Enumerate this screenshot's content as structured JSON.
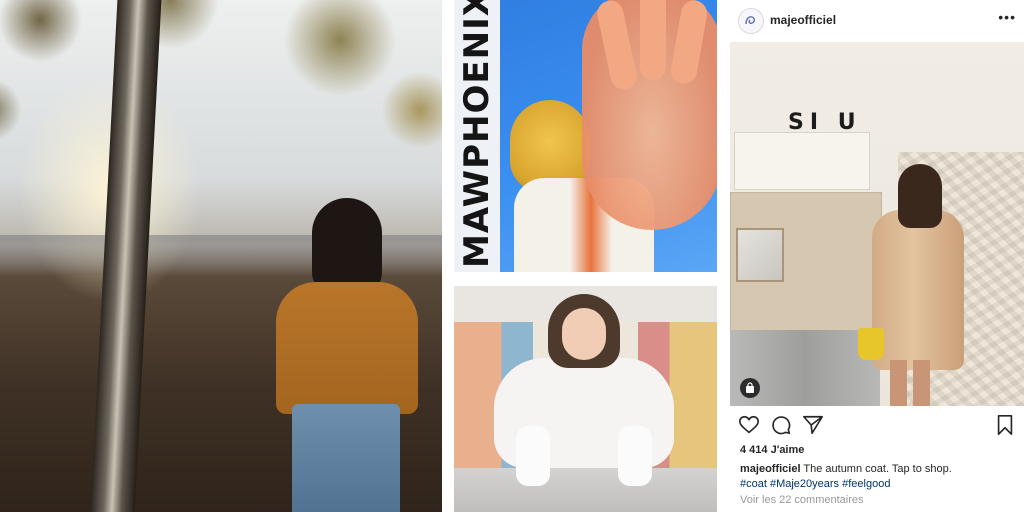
{
  "poster": {
    "title": "MAWPHOENIX"
  },
  "ig_photo": {
    "sign_text": "SI U"
  },
  "instagram": {
    "username": "majeofficiel",
    "more_icon": "more-horizontal-icon",
    "likes_text": "4 414 J'aime",
    "caption_user": "majeofficiel",
    "caption_text": "The autumn coat. Tap to shop.",
    "hashtags": "#coat #Maje20years #feelgood",
    "comments_link": "Voir les 22 commentaires"
  },
  "icons": {
    "like": "heart-icon",
    "comment": "comment-icon",
    "share": "paper-plane-icon",
    "save": "bookmark-icon",
    "shop": "shopping-bag-icon"
  },
  "colors": {
    "text": "#262626",
    "hashtag": "#003569",
    "muted": "#999999"
  }
}
